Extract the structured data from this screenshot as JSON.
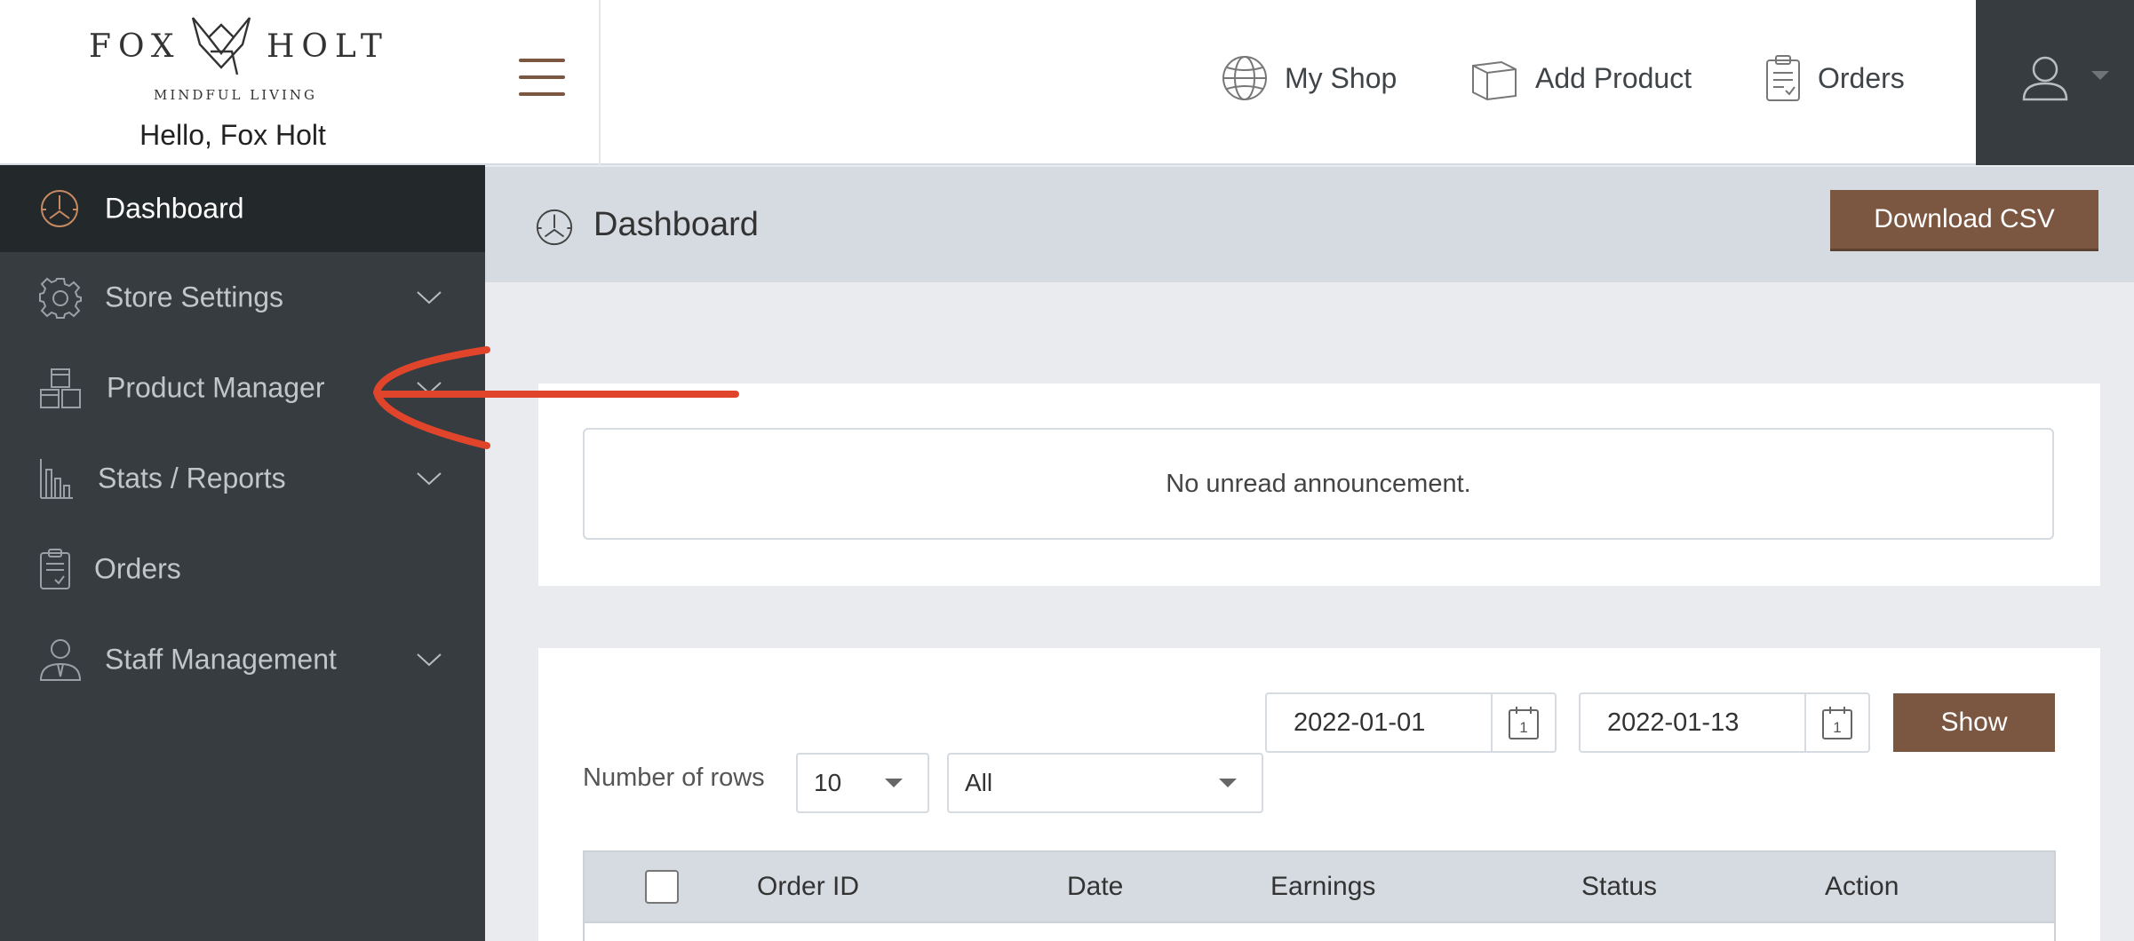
{
  "brand": {
    "logo_left": "FOX",
    "logo_right": "HOLT",
    "tagline": "MINDFUL LIVING",
    "greeting": "Hello, Fox Holt"
  },
  "topnav": {
    "items": [
      {
        "label": "My Shop",
        "icon": "globe-icon"
      },
      {
        "label": "Add Product",
        "icon": "box-icon"
      },
      {
        "label": "Orders",
        "icon": "clipboard-icon"
      }
    ],
    "user_icon": "user-icon"
  },
  "sidebar": {
    "items": [
      {
        "label": "Dashboard",
        "icon": "dashboard-gauge-icon",
        "active": true
      },
      {
        "label": "Store Settings",
        "icon": "gear-icon",
        "expandable": true
      },
      {
        "label": "Product Manager",
        "icon": "boxes-icon",
        "expandable": true
      },
      {
        "label": "Stats / Reports",
        "icon": "bar-chart-icon",
        "expandable": true
      },
      {
        "label": "Orders",
        "icon": "clipboard-icon",
        "expandable": false
      },
      {
        "label": "Staff Management",
        "icon": "staff-icon",
        "expandable": true
      }
    ]
  },
  "main": {
    "title": "Dashboard",
    "download_label": "Download CSV",
    "announcement": "No unread announcement.",
    "filters": {
      "date_from": "2022-01-01",
      "date_to": "2022-01-13",
      "calendar_day": "1",
      "show_label": "Show",
      "rows_label": "Number of rows",
      "rows_value": "10",
      "status_value": "All"
    },
    "table": {
      "columns": [
        "Order ID",
        "Date",
        "Earnings",
        "Status",
        "Action"
      ]
    }
  },
  "colors": {
    "accent": "#7b5741",
    "sidebar_bg": "#363c40",
    "sidebar_active": "#23282b",
    "header_band": "#d6dbe1",
    "annotation": "#e0452b"
  }
}
